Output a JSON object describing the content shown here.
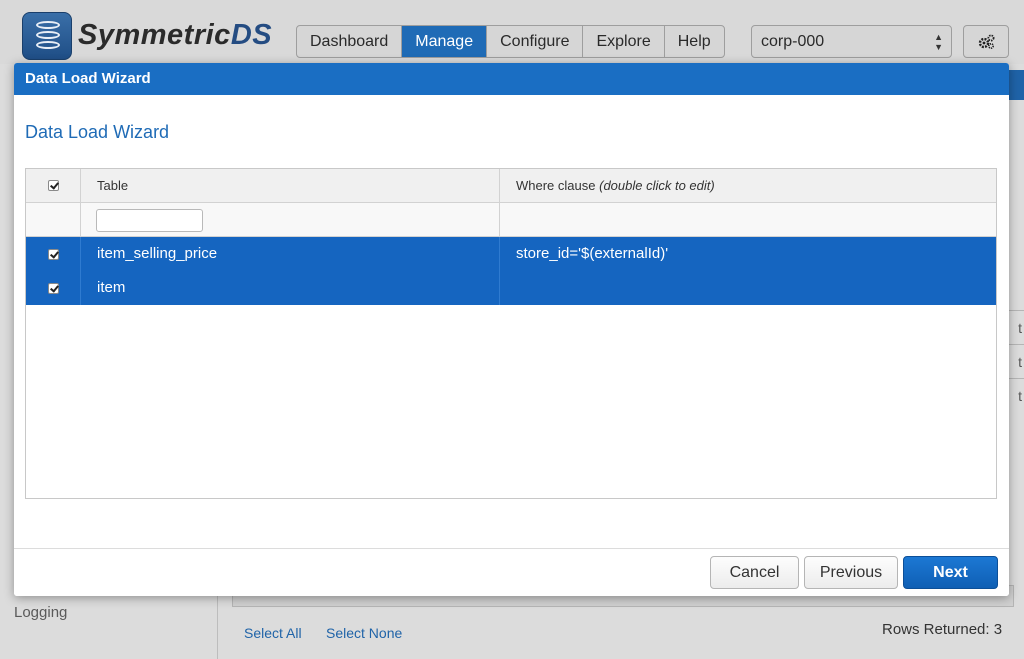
{
  "app": {
    "logo_text_main": "Symmetric",
    "logo_text_accent": "DS",
    "nav": [
      {
        "label": "Dashboard",
        "active": false
      },
      {
        "label": "Manage",
        "active": true
      },
      {
        "label": "Configure",
        "active": false
      },
      {
        "label": "Explore",
        "active": false
      },
      {
        "label": "Help",
        "active": false
      }
    ],
    "node_select": {
      "value": "corp-000"
    },
    "settings_icon": "gears-icon",
    "sidebar_item_logging": "Logging",
    "edge_cells": [
      "t",
      "t",
      "t"
    ],
    "select_all": "Select All",
    "select_none": "Select None",
    "rows_returned": "Rows Returned: 3",
    "accent_color": "#1f6bb6"
  },
  "modal": {
    "title": "Data Load Wizard",
    "heading": "Data Load Wizard",
    "grid": {
      "columns": {
        "table": "Table",
        "where": "Where clause",
        "where_hint": "(double click to edit)"
      },
      "header_checked": true,
      "filter_value": "",
      "rows": [
        {
          "checked": true,
          "table": "item_selling_price",
          "where": "store_id='$(externalId)'"
        },
        {
          "checked": true,
          "table": "item",
          "where": ""
        }
      ]
    },
    "buttons": {
      "cancel": "Cancel",
      "previous": "Previous",
      "next": "Next"
    }
  }
}
